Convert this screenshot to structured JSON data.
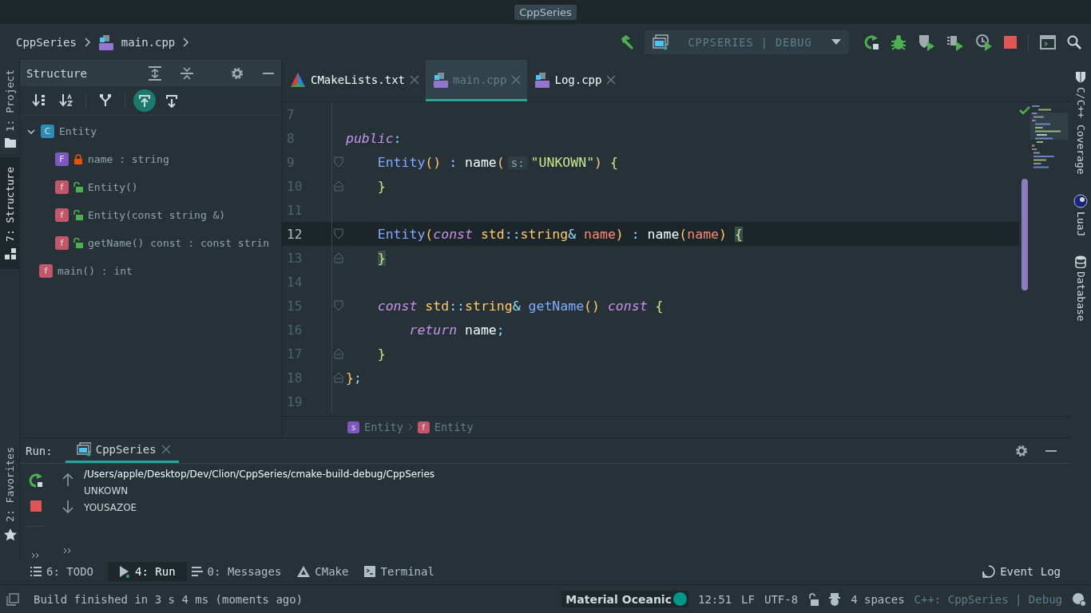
{
  "window": {
    "title": "CppSeries"
  },
  "breadcrumb": [
    "CppSeries",
    "main.cpp"
  ],
  "run_config": "CPPSERIES | DEBUG",
  "left_stripe": [
    {
      "label": "1: Project",
      "kind": "project",
      "selected": false
    },
    {
      "label": "7: Structure",
      "kind": "structure",
      "selected": true
    },
    {
      "label": "2: Favorites",
      "kind": "favorites",
      "selected": false
    }
  ],
  "structure": {
    "title": "Structure",
    "toolbar": [
      {
        "kind": "sort-visibility",
        "on": false
      },
      {
        "kind": "sort-alpha",
        "on": false
      },
      {
        "kind": "inherited",
        "on": false
      },
      {
        "kind": "scroll-from-source",
        "on": true
      },
      {
        "kind": "scroll-to-source",
        "on": false
      }
    ],
    "tree": [
      {
        "label": "Entity",
        "badge": "C",
        "kind": "class",
        "expanded": true,
        "children": [
          {
            "label": "name : string",
            "badge": "F",
            "kind": "field",
            "locked": true
          },
          {
            "label": "Entity()",
            "badge": "f",
            "kind": "method",
            "locked": false
          },
          {
            "label": "Entity(const string &)",
            "badge": "f",
            "kind": "method",
            "locked": false
          },
          {
            "label": "getName() const : const strin",
            "badge": "f",
            "kind": "method",
            "locked": false
          }
        ]
      },
      {
        "label": "main() : int",
        "badge": "f",
        "kind": "method"
      }
    ]
  },
  "editor": {
    "tabs": [
      {
        "label": "CMakeLists.txt",
        "kind": "cmake",
        "selected": false
      },
      {
        "label": "main.cpp",
        "kind": "cpp",
        "selected": true
      },
      {
        "label": "Log.cpp",
        "kind": "cpp",
        "selected": false
      }
    ],
    "lines": [
      {
        "number": "7",
        "current": false,
        "fold_start": false,
        "fold_end": false
      },
      {
        "number": "8",
        "current": false,
        "fold_start": false,
        "fold_end": false,
        "tokens": [
          {
            "kind": "kw",
            "text": "public"
          },
          {
            "kind": "punct",
            "text": ":"
          }
        ]
      },
      {
        "number": "9",
        "current": false,
        "fold_start": true,
        "fold_end": false,
        "tokens": [
          {
            "kind": "fn",
            "text": "    Entity"
          },
          {
            "kind": "paren",
            "text": "()"
          },
          {
            "kind": "punct",
            "text": " : "
          },
          {
            "kind": "plain",
            "text": "name"
          },
          {
            "kind": "paren",
            "text": "("
          },
          {
            "kind": "hint",
            "text": "s:"
          },
          {
            "kind": "str",
            "text": "\"UNKOWN\""
          },
          {
            "kind": "paren",
            "text": ") "
          },
          {
            "kind": "brace",
            "text": "{"
          }
        ]
      },
      {
        "number": "10",
        "current": false,
        "fold_start": false,
        "fold_end": true,
        "tokens": [
          {
            "kind": "brace",
            "text": "    }"
          }
        ]
      },
      {
        "number": "11",
        "current": false,
        "fold_start": false,
        "fold_end": false
      },
      {
        "number": "12",
        "current": true,
        "fold_start": true,
        "fold_end": false,
        "tokens": [
          {
            "kind": "fn",
            "text": "    Entity"
          },
          {
            "kind": "paren",
            "text": "("
          },
          {
            "kind": "kw",
            "text": "const "
          },
          {
            "kind": "type",
            "text": "std"
          },
          {
            "kind": "punct",
            "text": "::"
          },
          {
            "kind": "type",
            "text": "string"
          },
          {
            "kind": "punct",
            "text": "& "
          },
          {
            "kind": "param",
            "text": "name"
          },
          {
            "kind": "paren",
            "text": ")"
          },
          {
            "kind": "punct",
            "text": " : "
          },
          {
            "kind": "plain",
            "text": "name"
          },
          {
            "kind": "paren",
            "text": "("
          },
          {
            "kind": "param",
            "text": "name"
          },
          {
            "kind": "paren",
            "text": ") "
          },
          {
            "kind": "match",
            "text": "{"
          }
        ]
      },
      {
        "number": "13",
        "current": false,
        "fold_start": false,
        "fold_end": true,
        "tokens": [
          {
            "kind": "match",
            "text": "    }"
          }
        ]
      },
      {
        "number": "14",
        "current": false,
        "fold_start": false,
        "fold_end": false
      },
      {
        "number": "15",
        "current": false,
        "fold_start": true,
        "fold_end": false,
        "tokens": [
          {
            "kind": "kw",
            "text": "    const "
          },
          {
            "kind": "type",
            "text": "std"
          },
          {
            "kind": "punct",
            "text": "::"
          },
          {
            "kind": "type",
            "text": "string"
          },
          {
            "kind": "punct",
            "text": "& "
          },
          {
            "kind": "fn",
            "text": "getName"
          },
          {
            "kind": "paren",
            "text": "() "
          },
          {
            "kind": "kw",
            "text": "const "
          },
          {
            "kind": "brace",
            "text": "{"
          }
        ]
      },
      {
        "number": "16",
        "current": false,
        "fold_start": false,
        "fold_end": false,
        "tokens": [
          {
            "kind": "kw",
            "text": "        return "
          },
          {
            "kind": "plain",
            "text": "name"
          },
          {
            "kind": "punct",
            "text": ";"
          }
        ]
      },
      {
        "number": "17",
        "current": false,
        "fold_start": false,
        "fold_end": true,
        "tokens": [
          {
            "kind": "brace",
            "text": "    }"
          }
        ]
      },
      {
        "number": "18",
        "current": false,
        "fold_start": false,
        "fold_end": true,
        "tokens": [
          {
            "kind": "paren",
            "text": "}"
          },
          {
            "kind": "punct",
            "text": ";"
          }
        ]
      },
      {
        "number": "19",
        "current": false,
        "fold_start": false,
        "fold_end": false
      }
    ],
    "breadcrumb": [
      {
        "badge": "s",
        "label": "Entity",
        "kind": "struct"
      },
      {
        "badge": "f",
        "label": "Entity",
        "kind": "method"
      }
    ]
  },
  "right_stripe": [
    {
      "label": "C/C++ Coverage",
      "kind": "coverage"
    },
    {
      "label": "LuaJ",
      "kind": "luaj"
    },
    {
      "label": "Database",
      "kind": "database"
    }
  ],
  "run": {
    "label": "Run:",
    "tab": "CppSeries",
    "output": [
      "/Users/apple/Desktop/Dev/Clion/CppSeries/cmake-build-debug/CppSeries",
      "UNKOWN",
      "YOUSAZOE"
    ]
  },
  "tool_tabs": [
    {
      "label": "6: TODO",
      "kind": "todo",
      "selected": false
    },
    {
      "label": "4: Run",
      "kind": "run",
      "selected": true
    },
    {
      "label": "0: Messages",
      "kind": "messages",
      "selected": false
    },
    {
      "label": "CMake",
      "kind": "cmake",
      "selected": false
    },
    {
      "label": "Terminal",
      "kind": "terminal",
      "selected": false
    }
  ],
  "event_log": "Event Log",
  "status_bar": {
    "message": "Build finished in 3 s 4 ms (moments ago)",
    "theme": "Material Oceanic",
    "position": "12:51",
    "line_separator": "LF",
    "encoding": "UTF-8",
    "indent": "4 spaces",
    "context": "C++: CppSeries | Debug"
  }
}
